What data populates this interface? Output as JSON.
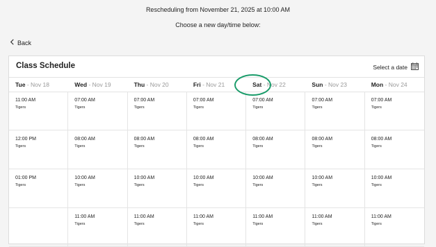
{
  "header": {
    "rescheduling_text": "Rescheduling from November 21, 2025 at 10:00 AM",
    "instruction": "Choose a new day/time below:",
    "back_label": "Back"
  },
  "schedule": {
    "title": "Class Schedule",
    "select_date_label": "Select a date",
    "days": [
      {
        "day": "Tue",
        "date": "Nov 18"
      },
      {
        "day": "Wed",
        "date": "Nov 19"
      },
      {
        "day": "Thu",
        "date": "Nov 20"
      },
      {
        "day": "Fri",
        "date": "Nov 21"
      },
      {
        "day": "Sat",
        "date": "Nov 22"
      },
      {
        "day": "Sun",
        "date": "Nov 23"
      },
      {
        "day": "Mon",
        "date": "Nov 24"
      }
    ],
    "rows": [
      [
        {
          "time": "11:00 AM",
          "team": "Tigers"
        },
        {
          "time": "07:00 AM",
          "team": "Tigers"
        },
        {
          "time": "07:00 AM",
          "team": "Tigers"
        },
        {
          "time": "07:00 AM",
          "team": "Tigers"
        },
        {
          "time": "07:00 AM",
          "team": "Tigers"
        },
        {
          "time": "07:00 AM",
          "team": "Tigers"
        },
        {
          "time": "07:00 AM",
          "team": "Tigers"
        }
      ],
      [
        {
          "time": "12:00 PM",
          "team": "Tigers"
        },
        {
          "time": "08:00 AM",
          "team": "Tigers"
        },
        {
          "time": "08:00 AM",
          "team": "Tigers"
        },
        {
          "time": "08:00 AM",
          "team": "Tigers"
        },
        {
          "time": "08:00 AM",
          "team": "Tigers"
        },
        {
          "time": "08:00 AM",
          "team": "Tigers"
        },
        {
          "time": "08:00 AM",
          "team": "Tigers"
        }
      ],
      [
        {
          "time": "01:00 PM",
          "team": "Tigers"
        },
        {
          "time": "10:00 AM",
          "team": "Tigers"
        },
        {
          "time": "10:00 AM",
          "team": "Tigers"
        },
        {
          "time": "10:00 AM",
          "team": "Tigers"
        },
        {
          "time": "10:00 AM",
          "team": "Tigers"
        },
        {
          "time": "10:00 AM",
          "team": "Tigers"
        },
        {
          "time": "10:00 AM",
          "team": "Tigers"
        }
      ],
      [
        null,
        {
          "time": "11:00 AM",
          "team": "Tigers"
        },
        {
          "time": "11:00 AM",
          "team": "Tigers"
        },
        {
          "time": "11:00 AM",
          "team": "Tigers"
        },
        {
          "time": "11:00 AM",
          "team": "Tigers"
        },
        {
          "time": "11:00 AM",
          "team": "Tigers"
        },
        {
          "time": "11:00 AM",
          "team": "Tigers"
        }
      ]
    ]
  },
  "icons": {
    "back": "chevron-left-icon",
    "calendar": "calendar-icon"
  },
  "colors": {
    "highlight": "#1a9c6a",
    "date_muted": "#999999"
  }
}
